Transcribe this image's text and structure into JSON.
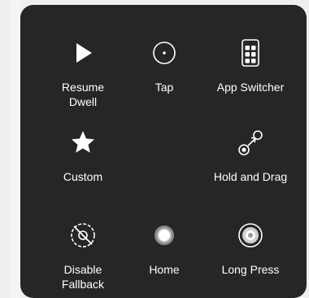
{
  "menu": {
    "items": [
      {
        "label": "Resume\nDwell",
        "icon": "play-icon"
      },
      {
        "label": "Tap",
        "icon": "tap-circle-icon"
      },
      {
        "label": "App Switcher",
        "icon": "app-switcher-icon"
      },
      {
        "label": "Custom",
        "icon": "star-icon"
      },
      {
        "label": "Hold and Drag",
        "icon": "hold-drag-icon"
      },
      {
        "label": "Disable\nFallback",
        "icon": "disable-fallback-icon"
      },
      {
        "label": "Home",
        "icon": "home-icon"
      },
      {
        "label": "Long Press",
        "icon": "long-press-icon"
      }
    ]
  },
  "colors": {
    "panel_background": "#262626",
    "text": "#ffffff"
  }
}
